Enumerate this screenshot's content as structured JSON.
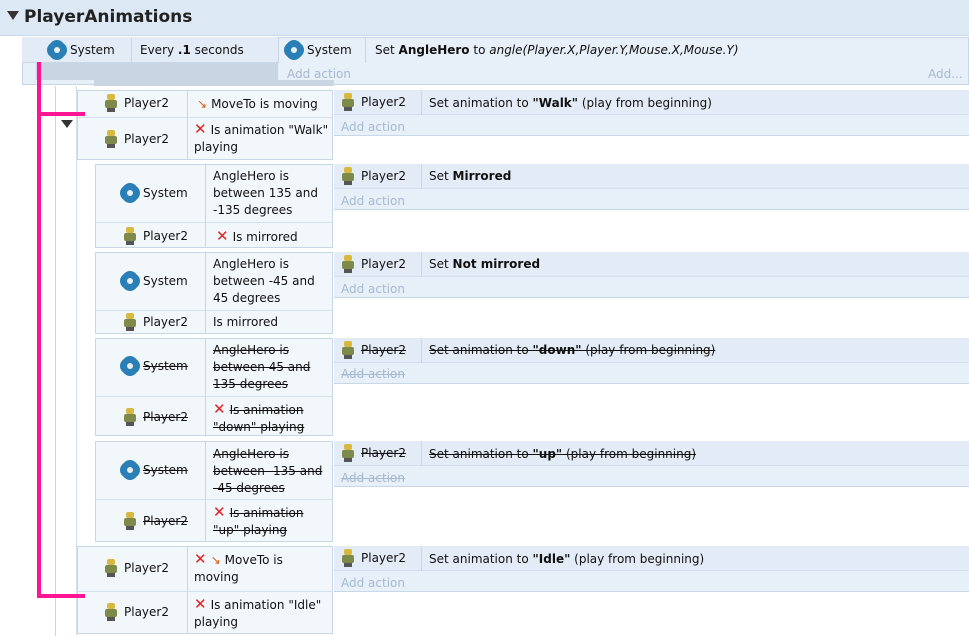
{
  "group": {
    "title": "PlayerAnimations"
  },
  "icons": {
    "system": "gear-icon",
    "player": "player-sprite-icon",
    "invert": "red-x-icon",
    "moveto": "moveto-arrow-icon",
    "collapse": "triangle-down-icon"
  },
  "colors": {
    "header_bg": "#dde8f5",
    "event_bg": "#e7eff9",
    "annotation_line": "#ff1493",
    "invert_x": "#dd2222"
  },
  "ev1": {
    "cond_obj": "System",
    "cond_pre": "Every ",
    "cond_bold": ".1",
    "cond_post": " seconds",
    "act_obj": "System",
    "act_pre": "Set ",
    "act_bold": "AngleHero",
    "act_mid": " to ",
    "act_ital": "angle(Player.X,Player.Y,Mouse.X,Mouse.Y)",
    "add_action": "Add action",
    "add_more": "Add..."
  },
  "ev2": {
    "c1_obj": "Player2",
    "c1_text": "MoveTo is moving",
    "c2_obj": "Player2",
    "c2_text": "Is animation \"Walk\" playing",
    "act_obj": "Player2",
    "act_pre": "Set animation to ",
    "act_bold": "\"Walk\"",
    "act_post": " (play from beginning)",
    "add_action": "Add action"
  },
  "sub1": {
    "c1_obj": "System",
    "c1_text": "AngleHero is between 135 and -135 degrees",
    "c2_obj": "Player2",
    "c2_text": "Is mirrored",
    "act_obj": "Player2",
    "act_pre": "Set ",
    "act_bold": "Mirrored",
    "add_action": "Add action"
  },
  "sub2": {
    "c1_obj": "System",
    "c1_text": "AngleHero is between -45 and 45 degrees",
    "c2_obj": "Player2",
    "c2_text": "Is mirrored",
    "act_obj": "Player2",
    "act_pre": "Set ",
    "act_bold": "Not mirrored",
    "add_action": "Add action"
  },
  "sub3": {
    "c1_obj": "System",
    "c1_text": "AngleHero is between 45 and 135 degrees",
    "c2_obj": "Player2",
    "c2_text": "Is animation \"down\" playing",
    "act_obj": "Player2",
    "act_pre": "Set animation to ",
    "act_bold": "\"down\"",
    "act_post": " (play from beginning)",
    "add_action": "Add action"
  },
  "sub4": {
    "c1_obj": "System",
    "c1_text": "AngleHero is between -135 and -45 degrees",
    "c2_obj": "Player2",
    "c2_text": "Is animation \"up\" playing",
    "act_obj": "Player2",
    "act_pre": "Set animation to ",
    "act_bold": "\"up\"",
    "act_post": " (play from beginning)",
    "add_action": "Add action"
  },
  "ev3": {
    "c1_obj": "Player2",
    "c1_text": "MoveTo is moving",
    "c2_obj": "Player2",
    "c2_text": "Is animation \"Idle\" playing",
    "act_obj": "Player2",
    "act_pre": "Set animation to ",
    "act_bold": "\"Idle\"",
    "act_post": " (play from beginning)",
    "add_action": "Add action"
  }
}
